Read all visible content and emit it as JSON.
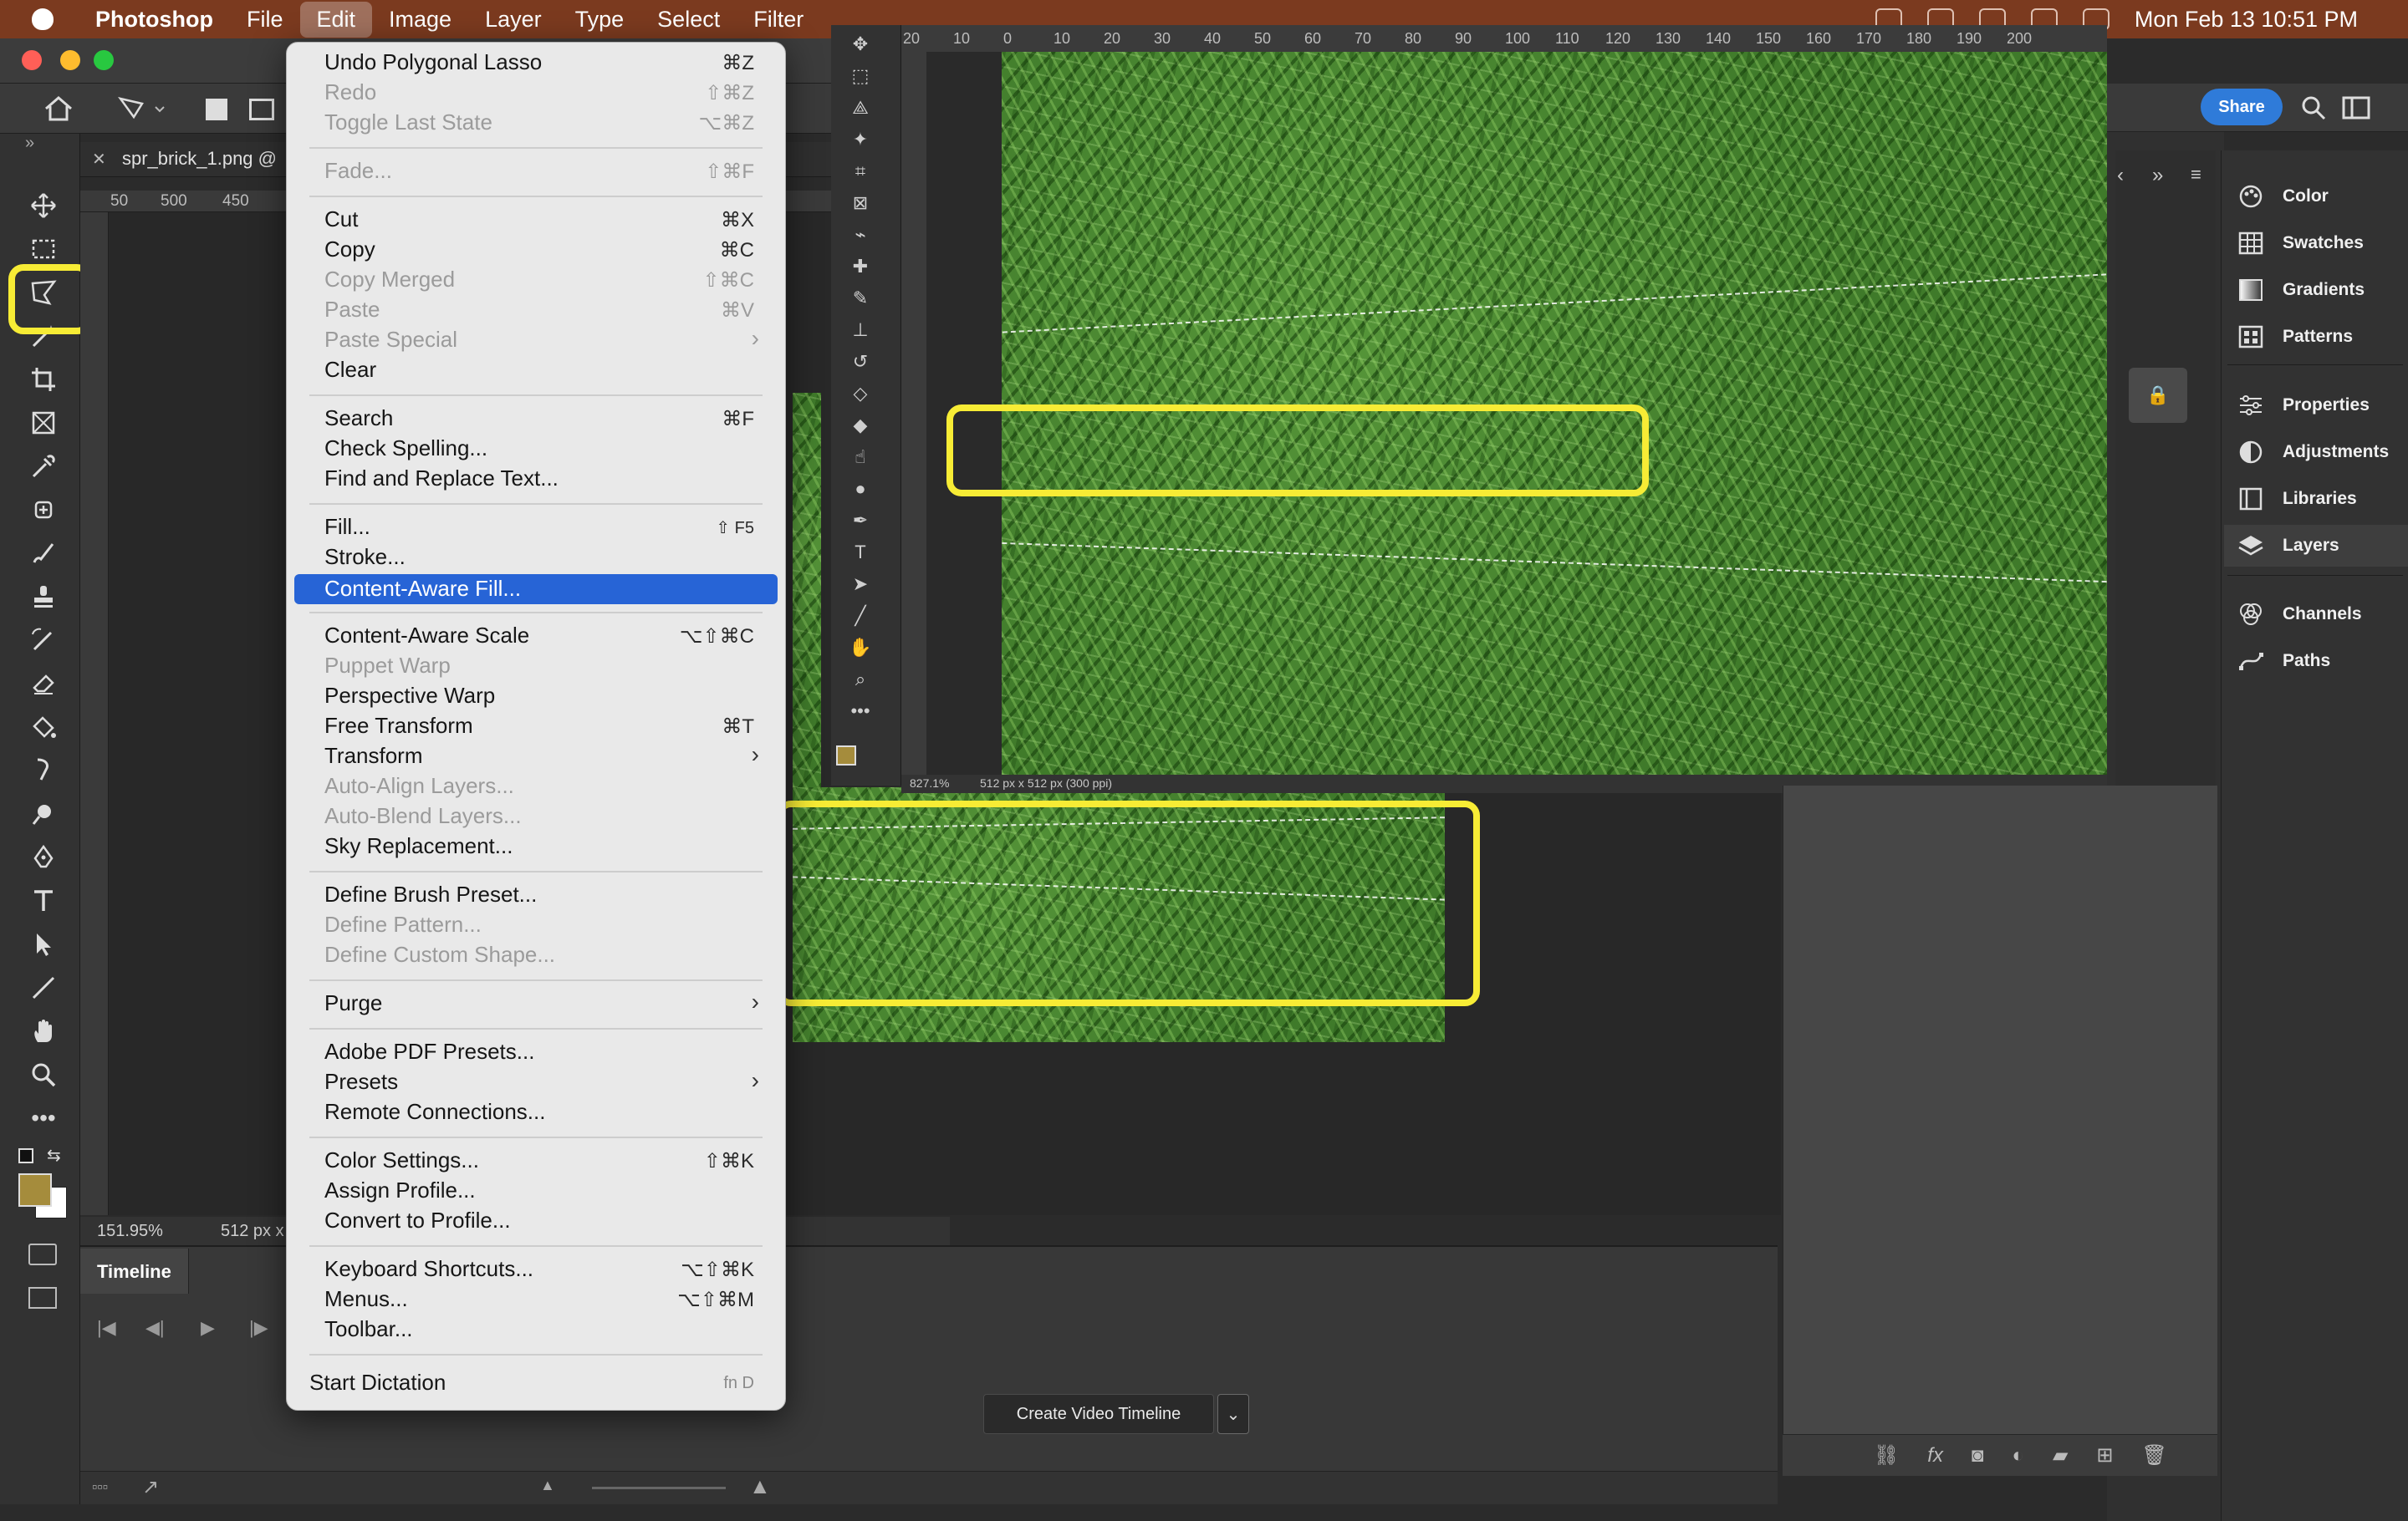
{
  "menubar": {
    "app_name": "Photoshop",
    "items": [
      "File",
      "Edit",
      "Image",
      "Layer",
      "Type",
      "Select",
      "Filter"
    ],
    "clock": "Mon Feb 13  10:51 PM"
  },
  "document": {
    "tab_name": "spr_brick_1.png @",
    "zoom": "151.95%",
    "size_info": "512 px x",
    "ruler_ticks": [
      "50",
      "500",
      "450"
    ]
  },
  "zoomed_window": {
    "zoom": "827.1%",
    "size_info": "512 px x 512 px (300 ppi)",
    "ruler_ticks": [
      "20",
      "10",
      "0",
      "10",
      "20",
      "30",
      "40",
      "50",
      "60",
      "70",
      "80",
      "90",
      "100",
      "110",
      "120",
      "130",
      "140",
      "150",
      "160",
      "170",
      "180",
      "190",
      "200"
    ]
  },
  "edit_menu": {
    "items": [
      {
        "label": "Undo Polygonal Lasso",
        "shortcut": "⌘Z",
        "enabled": true
      },
      {
        "label": "Redo",
        "shortcut": "⇧⌘Z",
        "enabled": false
      },
      {
        "label": "Toggle Last State",
        "shortcut": "⌥⌘Z",
        "enabled": false
      },
      {
        "label": "Fade...",
        "shortcut": "⇧⌘F",
        "enabled": false
      },
      {
        "label": "Cut",
        "shortcut": "⌘X",
        "enabled": true
      },
      {
        "label": "Copy",
        "shortcut": "⌘C",
        "enabled": true
      },
      {
        "label": "Copy Merged",
        "shortcut": "⇧⌘C",
        "enabled": false
      },
      {
        "label": "Paste",
        "shortcut": "⌘V",
        "enabled": false
      },
      {
        "label": "Paste Special",
        "shortcut": "",
        "enabled": false,
        "submenu": true
      },
      {
        "label": "Clear",
        "shortcut": "",
        "enabled": true
      },
      {
        "label": "Search",
        "shortcut": "⌘F",
        "enabled": true
      },
      {
        "label": "Check Spelling...",
        "shortcut": "",
        "enabled": true
      },
      {
        "label": "Find and Replace Text...",
        "shortcut": "",
        "enabled": true
      },
      {
        "label": "Fill...",
        "shortcut": "⇧ F5",
        "enabled": true
      },
      {
        "label": "Stroke...",
        "shortcut": "",
        "enabled": true
      },
      {
        "label": "Content-Aware Fill...",
        "shortcut": "",
        "enabled": true,
        "highlighted": true
      },
      {
        "label": "Content-Aware Scale",
        "shortcut": "⌥⇧⌘C",
        "enabled": true
      },
      {
        "label": "Puppet Warp",
        "shortcut": "",
        "enabled": false
      },
      {
        "label": "Perspective Warp",
        "shortcut": "",
        "enabled": true
      },
      {
        "label": "Free Transform",
        "shortcut": "⌘T",
        "enabled": true
      },
      {
        "label": "Transform",
        "shortcut": "",
        "enabled": true,
        "submenu": true
      },
      {
        "label": "Auto-Align Layers...",
        "shortcut": "",
        "enabled": false
      },
      {
        "label": "Auto-Blend Layers...",
        "shortcut": "",
        "enabled": false
      },
      {
        "label": "Sky Replacement...",
        "shortcut": "",
        "enabled": true
      },
      {
        "label": "Define Brush Preset...",
        "shortcut": "",
        "enabled": true
      },
      {
        "label": "Define Pattern...",
        "shortcut": "",
        "enabled": false
      },
      {
        "label": "Define Custom Shape...",
        "shortcut": "",
        "enabled": false
      },
      {
        "label": "Purge",
        "shortcut": "",
        "enabled": true,
        "submenu": true
      },
      {
        "label": "Adobe PDF Presets...",
        "shortcut": "",
        "enabled": true
      },
      {
        "label": "Presets",
        "shortcut": "",
        "enabled": true,
        "submenu": true
      },
      {
        "label": "Remote Connections...",
        "shortcut": "",
        "enabled": true
      },
      {
        "label": "Color Settings...",
        "shortcut": "⇧⌘K",
        "enabled": true
      },
      {
        "label": "Assign Profile...",
        "shortcut": "",
        "enabled": true
      },
      {
        "label": "Convert to Profile...",
        "shortcut": "",
        "enabled": true
      },
      {
        "label": "Keyboard Shortcuts...",
        "shortcut": "⌥⇧⌘K",
        "enabled": true
      },
      {
        "label": "Menus...",
        "shortcut": "⌥⇧⌘M",
        "enabled": true
      },
      {
        "label": "Toolbar...",
        "shortcut": "",
        "enabled": true
      },
      {
        "label": "Start Dictation",
        "shortcut": "fn D",
        "enabled": true
      }
    ]
  },
  "timeline": {
    "tab_label": "Timeline",
    "create_button": "Create Video Timeline"
  },
  "header": {
    "share_label": "Share"
  },
  "side_panels": [
    {
      "label": "Color",
      "icon": "color-palette-icon"
    },
    {
      "label": "Swatches",
      "icon": "swatches-grid-icon"
    },
    {
      "label": "Gradients",
      "icon": "gradient-icon"
    },
    {
      "label": "Patterns",
      "icon": "patterns-grid-icon"
    },
    {
      "label": "Properties",
      "icon": "sliders-icon"
    },
    {
      "label": "Adjustments",
      "icon": "half-circle-icon"
    },
    {
      "label": "Libraries",
      "icon": "library-icon"
    },
    {
      "label": "Layers",
      "icon": "layers-stack-icon"
    },
    {
      "label": "Channels",
      "icon": "channels-circles-icon"
    },
    {
      "label": "Paths",
      "icon": "paths-icon"
    }
  ],
  "colors": {
    "menubar_bg": "#7b3a1f",
    "highlight_annotation": "#f7ec35",
    "menu_selection": "#2764d6",
    "share_button": "#2f7bd9",
    "foreground_swatch": "#a58c3c"
  }
}
